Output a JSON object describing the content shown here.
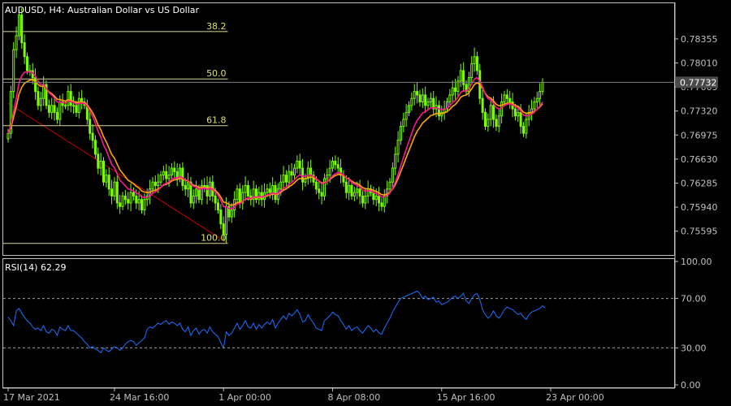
{
  "colors": {
    "background": "#000000",
    "frame": "#c0c0c0",
    "axis_text": "#c0c0c0",
    "bull_candle": "#7cfc00",
    "bear_candle": "#7cfc00",
    "ma_fast": "#ff1493",
    "ma_slow": "#ffa500",
    "fib_line": "#d8d89c",
    "fib_label": "#e0e070",
    "trend_line": "#cc0000",
    "rsi_line": "#1e6fff",
    "rsi_level": "#a0a0a0",
    "price_tag_bg": "#4a4a4a",
    "price_tag_text": "#ffffff"
  },
  "chart_data": {
    "type": "candlestick",
    "title": "AUDUSD, H4:  Australian Dollar vs US Dollar",
    "symbol": "AUDUSD",
    "timeframe": "H4",
    "description": "Australian Dollar vs US Dollar",
    "current_price_label": "0.77732",
    "current_price": 0.77732,
    "y_range": [
      0.753,
      0.7882
    ],
    "y_ticks": [
      {
        "value": 0.78355,
        "label": "0.78355"
      },
      {
        "value": 0.7801,
        "label": "0.78010"
      },
      {
        "value": 0.77665,
        "label": "0.77665"
      },
      {
        "value": 0.7732,
        "label": "0.77320"
      },
      {
        "value": 0.76975,
        "label": "0.76975"
      },
      {
        "value": 0.7663,
        "label": "0.76630"
      },
      {
        "value": 0.76285,
        "label": "0.76285"
      },
      {
        "value": 0.7594,
        "label": "0.75940"
      },
      {
        "value": 0.75595,
        "label": "0.75595"
      }
    ],
    "x_ticks": [
      {
        "index": 0,
        "label": "17 Mar 2021"
      },
      {
        "index": 39,
        "label": "24 Mar 16:00"
      },
      {
        "index": 79,
        "label": "1 Apr 00:00"
      },
      {
        "index": 119,
        "label": "8 Apr 08:00"
      },
      {
        "index": 159,
        "label": "15 Apr 16:00"
      },
      {
        "index": 199,
        "label": "23 Apr 00:00"
      }
    ],
    "fibonacci": {
      "levels": [
        {
          "label": "38.2",
          "price": 0.7846
        },
        {
          "label": "50.0",
          "price": 0.7778
        },
        {
          "label": "61.8",
          "price": 0.7711
        },
        {
          "label": "100.0",
          "price": 0.7542
        }
      ],
      "start_index": 0,
      "end_index": 80,
      "trend_start": {
        "index": 0,
        "price": 0.7743
      },
      "trend_end": {
        "index": 80,
        "price": 0.7542
      }
    },
    "close": [
      0.77,
      0.776,
      0.782,
      0.784,
      0.787,
      0.783,
      0.781,
      0.779,
      0.779,
      0.778,
      0.776,
      0.774,
      0.775,
      0.777,
      0.774,
      0.773,
      0.774,
      0.773,
      0.772,
      0.7745,
      0.774,
      0.774,
      0.776,
      0.774,
      0.774,
      0.773,
      0.775,
      0.7745,
      0.774,
      0.772,
      0.77,
      0.769,
      0.767,
      0.765,
      0.766,
      0.763,
      0.764,
      0.762,
      0.761,
      0.763,
      0.76,
      0.7595,
      0.761,
      0.7605,
      0.76,
      0.7615,
      0.761,
      0.76,
      0.7605,
      0.759,
      0.7605,
      0.761,
      0.762,
      0.763,
      0.7625,
      0.763,
      0.764,
      0.7645,
      0.7635,
      0.764,
      0.765,
      0.7645,
      0.7635,
      0.765,
      0.7625,
      0.762,
      0.763,
      0.76,
      0.761,
      0.762,
      0.7605,
      0.7625,
      0.7625,
      0.761,
      0.763,
      0.761,
      0.76,
      0.759,
      0.757,
      0.7555,
      0.7595,
      0.758,
      0.759,
      0.7605,
      0.762,
      0.76,
      0.7615,
      0.7625,
      0.761,
      0.7605,
      0.762,
      0.7605,
      0.7615,
      0.7605,
      0.7615,
      0.762,
      0.7615,
      0.7625,
      0.7605,
      0.762,
      0.763,
      0.764,
      0.763,
      0.7645,
      0.764,
      0.765,
      0.766,
      0.765,
      0.763,
      0.7635,
      0.765,
      0.764,
      0.763,
      0.762,
      0.7615,
      0.761,
      0.7635,
      0.764,
      0.765,
      0.766,
      0.7655,
      0.765,
      0.764,
      0.763,
      0.7615,
      0.7625,
      0.761,
      0.7615,
      0.762,
      0.761,
      0.76,
      0.761,
      0.762,
      0.7615,
      0.7605,
      0.761,
      0.76,
      0.7595,
      0.761,
      0.762,
      0.763,
      0.765,
      0.767,
      0.769,
      0.771,
      0.772,
      0.773,
      0.774,
      0.775,
      0.776,
      0.7755,
      0.7745,
      0.7755,
      0.774,
      0.7745,
      0.775,
      0.7735,
      0.774,
      0.7725,
      0.773,
      0.7735,
      0.7745,
      0.7755,
      0.7765,
      0.776,
      0.7775,
      0.779,
      0.777,
      0.776,
      0.778,
      0.78,
      0.781,
      0.779,
      0.775,
      0.773,
      0.771,
      0.772,
      0.774,
      0.772,
      0.771,
      0.7725,
      0.7745,
      0.7755,
      0.775,
      0.7745,
      0.7735,
      0.7725,
      0.773,
      0.771,
      0.77,
      0.772,
      0.773,
      0.7735,
      0.7745,
      0.775,
      0.776,
      0.7773
    ],
    "rsi": {
      "label": "RSI(14) 62.29",
      "period": 14,
      "value": 62.29,
      "y_range": [
        0,
        100
      ],
      "levels": [
        30,
        70
      ],
      "y_ticks": [
        {
          "value": 100,
          "label": "100.00"
        },
        {
          "value": 70,
          "label": "70.00"
        },
        {
          "value": 30,
          "label": "30.00"
        },
        {
          "value": 0,
          "label": "0.00"
        }
      ],
      "values": [
        55,
        52,
        48,
        60,
        62,
        58,
        55,
        52,
        50,
        47,
        45,
        46,
        44,
        48,
        43,
        42,
        45,
        44,
        40,
        47,
        45,
        44,
        48,
        44,
        44,
        42,
        40,
        38,
        35,
        33,
        30,
        31,
        29,
        28,
        26,
        30,
        28,
        27,
        29,
        31,
        30,
        28,
        30,
        33,
        35,
        36,
        35,
        32,
        34,
        36,
        38,
        45,
        47,
        46,
        48,
        50,
        49,
        51,
        52,
        49,
        51,
        50,
        48,
        50,
        45,
        43,
        47,
        40,
        44,
        46,
        41,
        44,
        45,
        42,
        47,
        43,
        41,
        39,
        34,
        30,
        43,
        40,
        42,
        46,
        50,
        45,
        48,
        52,
        47,
        46,
        50,
        45,
        49,
        46,
        49,
        51,
        49,
        53,
        46,
        50,
        53,
        56,
        53,
        58,
        56,
        58,
        61,
        57,
        51,
        52,
        57,
        53,
        50,
        46,
        45,
        44,
        52,
        54,
        56,
        59,
        57,
        56,
        52,
        49,
        45,
        48,
        44,
        46,
        47,
        44,
        42,
        45,
        48,
        46,
        43,
        45,
        42,
        41,
        46,
        50,
        54,
        59,
        63,
        67,
        70,
        71,
        72,
        73,
        74,
        75,
        76,
        74,
        70,
        72,
        69,
        70,
        71,
        67,
        68,
        65,
        66,
        67,
        69,
        71,
        72,
        70,
        72,
        74,
        68,
        66,
        70,
        73,
        74,
        69,
        61,
        57,
        54,
        56,
        60,
        56,
        54,
        57,
        61,
        63,
        62,
        61,
        59,
        57,
        58,
        55,
        53,
        57,
        59,
        60,
        61,
        62,
        64,
        62.29
      ]
    }
  }
}
